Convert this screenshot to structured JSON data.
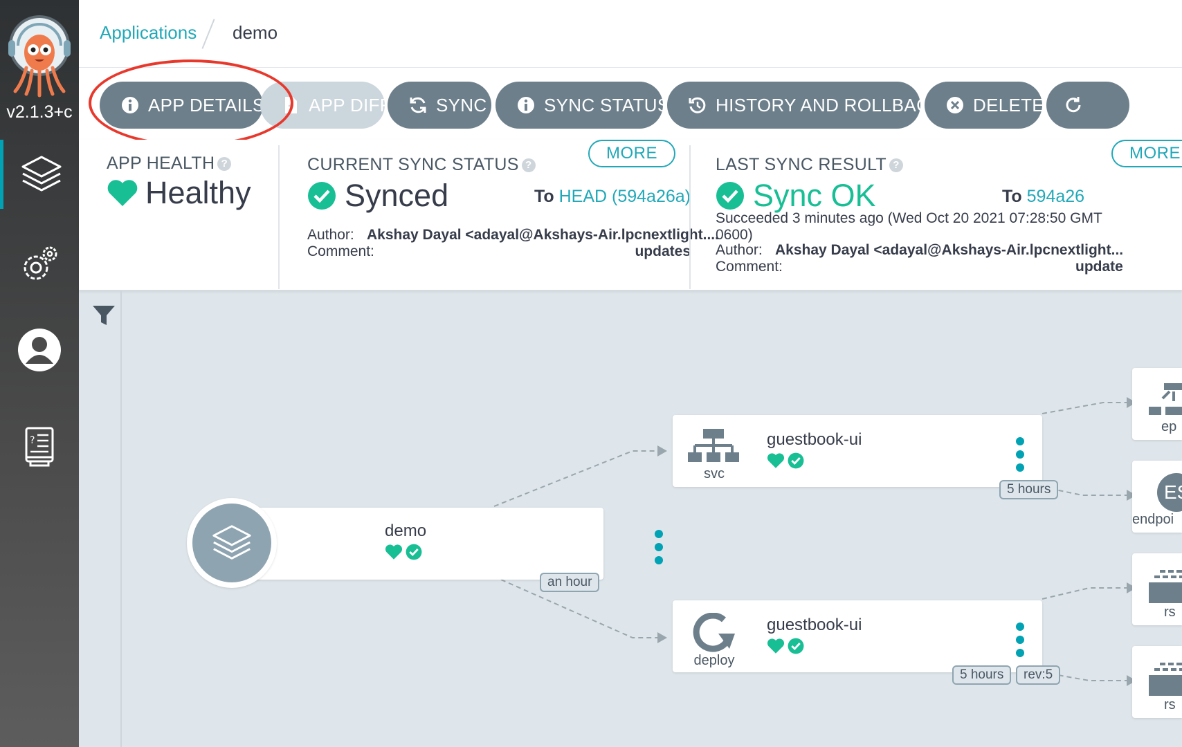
{
  "sidebar": {
    "version": "v2.1.3+c",
    "items": [
      {
        "name": "applications",
        "icon": "layers-icon",
        "active": true
      },
      {
        "name": "settings",
        "icon": "gears-icon",
        "active": false
      },
      {
        "name": "user-info",
        "icon": "user-icon",
        "active": false
      },
      {
        "name": "documentation",
        "icon": "book-icon",
        "active": false
      }
    ]
  },
  "breadcrumb": {
    "parent": "Applications",
    "current": "demo"
  },
  "toolbar": {
    "app_details": "APP DETAILS",
    "app_diff": "APP DIFF",
    "sync": "SYNC",
    "sync_status": "SYNC STATUS",
    "history": "HISTORY AND ROLLBACK",
    "delete": "DELETE"
  },
  "app_health": {
    "label": "APP HEALTH",
    "value": "Healthy"
  },
  "current_sync": {
    "label": "CURRENT SYNC STATUS",
    "more": "MORE",
    "value": "Synced",
    "to_prefix": "To",
    "target": "HEAD (594a26a)",
    "author_label": "Author:",
    "author": "Akshay Dayal <adayal@Akshays-Air.lpcnextlight....",
    "comment_label": "Comment:",
    "comment": "updates"
  },
  "last_sync": {
    "label": "LAST SYNC RESULT",
    "more": "MORE",
    "value": "Sync OK",
    "to_prefix": "To",
    "target": "594a26",
    "succeeded": "Succeeded 3 minutes ago (Wed Oct 20 2021 07:28:50 GMT",
    "succeeded_cont": "0600)",
    "author_label": "Author:",
    "author": "Akshay Dayal <adayal@Akshays-Air.lpcnextlight...",
    "comment_label": "Comment:",
    "comment": "update"
  },
  "graph": {
    "app_node": {
      "title": "demo",
      "age": "an hour"
    },
    "svc_node": {
      "title": "guestbook-ui",
      "kind": "svc",
      "age": "5 hours"
    },
    "deploy_node": {
      "title": "guestbook-ui",
      "kind": "deploy",
      "age": "5 hours",
      "rev": "rev:5"
    },
    "right_nodes": [
      {
        "kind": "ep"
      },
      {
        "kind": "endpoi",
        "badge": "ES"
      },
      {
        "kind": "rs"
      },
      {
        "kind": "rs"
      }
    ]
  },
  "colors": {
    "accent": "#21a8b8",
    "healthy": "#18be94",
    "button": "#6d7f8b",
    "highlight": "#e8382c"
  }
}
